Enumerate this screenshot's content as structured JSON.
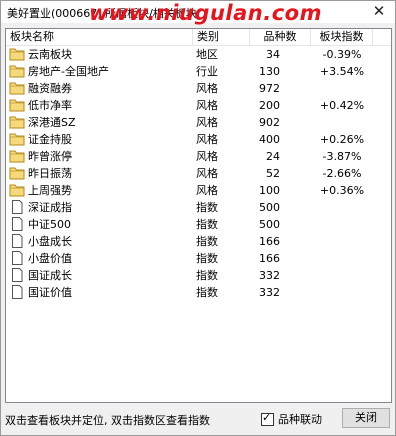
{
  "window": {
    "title": "美好置业(000667)  所属板块/相关板块",
    "watermark": "www.niugulan.com"
  },
  "table": {
    "headers": {
      "name": "板块名称",
      "type": "类别",
      "count": "品种数",
      "index": "板块指数"
    },
    "rows": [
      {
        "icon": "folder-icon",
        "name": "云南板块",
        "type": "地区",
        "count": "34",
        "index": "-0.39%"
      },
      {
        "icon": "folder-icon",
        "name": "房地产-全国地产",
        "type": "行业",
        "count": "130",
        "index": "+3.54%"
      },
      {
        "icon": "folder-icon",
        "name": "融资融券",
        "type": "风格",
        "count": "972",
        "index": ""
      },
      {
        "icon": "folder-icon",
        "name": "低市净率",
        "type": "风格",
        "count": "200",
        "index": "+0.42%"
      },
      {
        "icon": "folder-icon",
        "name": "深港通SZ",
        "type": "风格",
        "count": "902",
        "index": ""
      },
      {
        "icon": "folder-icon",
        "name": "证金持股",
        "type": "风格",
        "count": "400",
        "index": "+0.26%"
      },
      {
        "icon": "folder-icon",
        "name": "昨曾涨停",
        "type": "风格",
        "count": "24",
        "index": "-3.87%"
      },
      {
        "icon": "folder-icon",
        "name": "昨日振荡",
        "type": "风格",
        "count": "52",
        "index": "-2.66%"
      },
      {
        "icon": "folder-icon",
        "name": "上周强势",
        "type": "风格",
        "count": "100",
        "index": "+0.36%"
      },
      {
        "icon": "document-icon",
        "name": "深证成指",
        "type": "指数",
        "count": "500",
        "index": ""
      },
      {
        "icon": "document-icon",
        "name": "中证500",
        "type": "指数",
        "count": "500",
        "index": ""
      },
      {
        "icon": "document-icon",
        "name": "小盘成长",
        "type": "指数",
        "count": "166",
        "index": ""
      },
      {
        "icon": "document-icon",
        "name": "小盘价值",
        "type": "指数",
        "count": "166",
        "index": ""
      },
      {
        "icon": "document-icon",
        "name": "国证成长",
        "type": "指数",
        "count": "332",
        "index": ""
      },
      {
        "icon": "document-icon",
        "name": "国证价值",
        "type": "指数",
        "count": "332",
        "index": ""
      }
    ]
  },
  "footer": {
    "hint": "双击查看板块并定位, 双击指数区查看指数",
    "linkage_label": "品种联动",
    "linkage_checked": true,
    "close_label": "关闭"
  },
  "colors": {
    "watermark": "#e8131b",
    "folder_fill": "#f5d97a",
    "folder_stroke": "#b48a1e"
  }
}
